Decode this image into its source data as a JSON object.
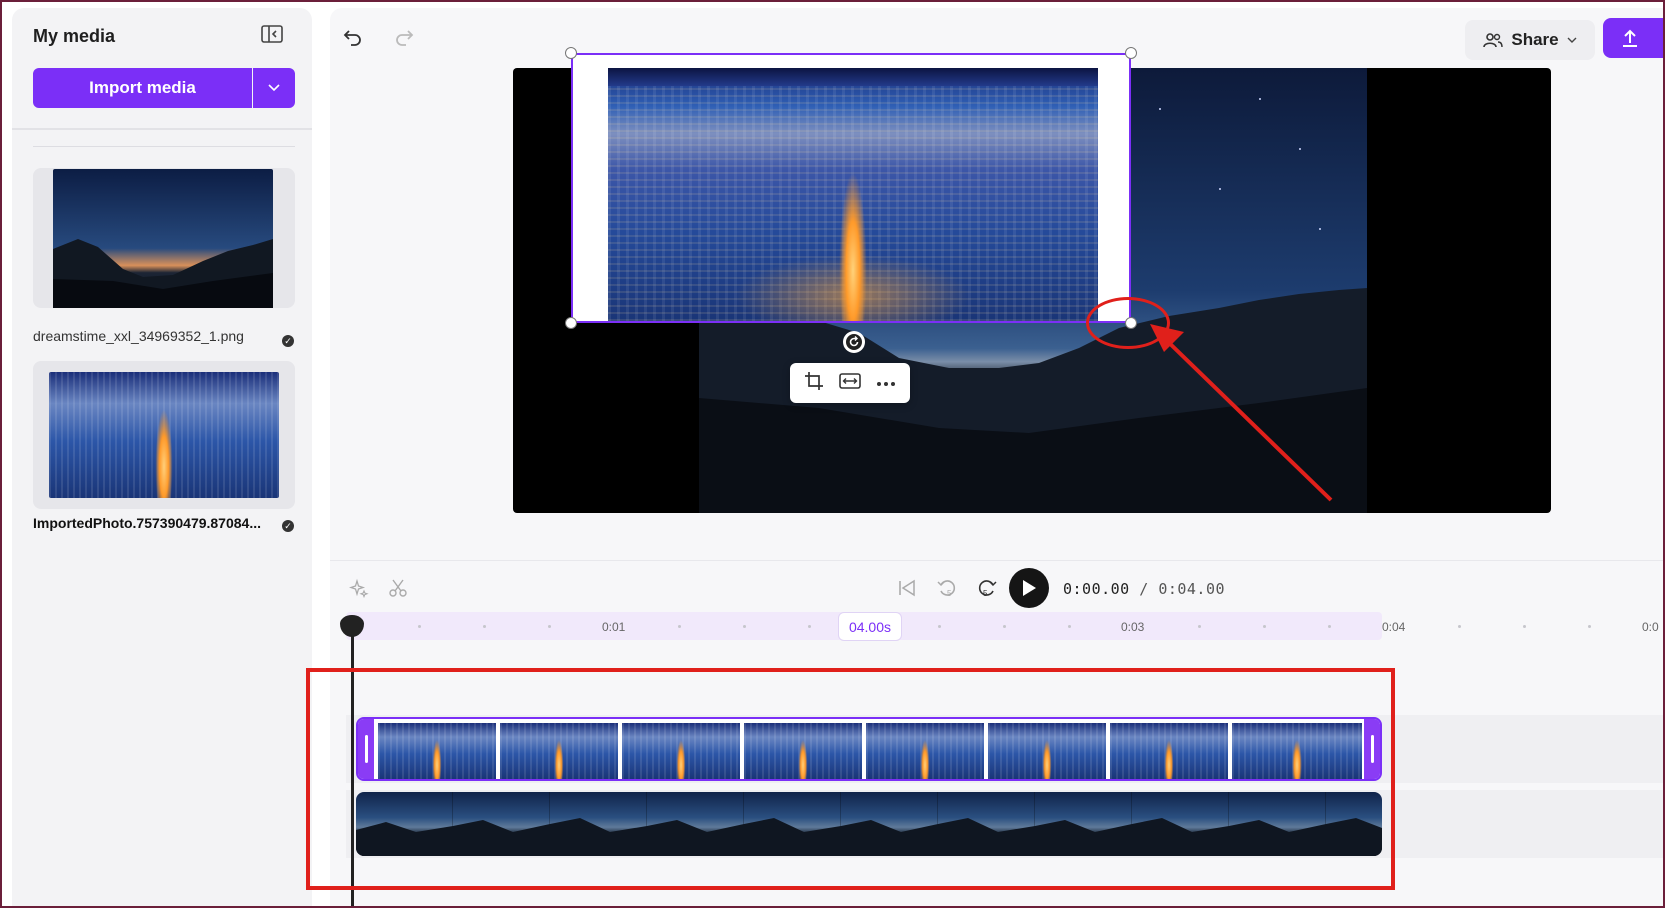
{
  "sidebar": {
    "title": "My media",
    "import_label": "Import media",
    "media": [
      {
        "name": "dreamstime_xxl_34969352_1.png"
      },
      {
        "name": "ImportedPhoto.757390479.87084..."
      }
    ]
  },
  "header": {
    "share_label": "Share"
  },
  "playback": {
    "current_time": "0:00.00",
    "separator": "/",
    "total_time": "0:04.00",
    "skip_back_label": "5",
    "skip_forward_label": "5"
  },
  "timeline": {
    "duration_badge": "04.00s",
    "ticks": [
      "0:01",
      "0:03",
      "0:04",
      "0:0"
    ]
  },
  "colors": {
    "accent": "#7b2ff7",
    "annotation": "#e0201b"
  }
}
